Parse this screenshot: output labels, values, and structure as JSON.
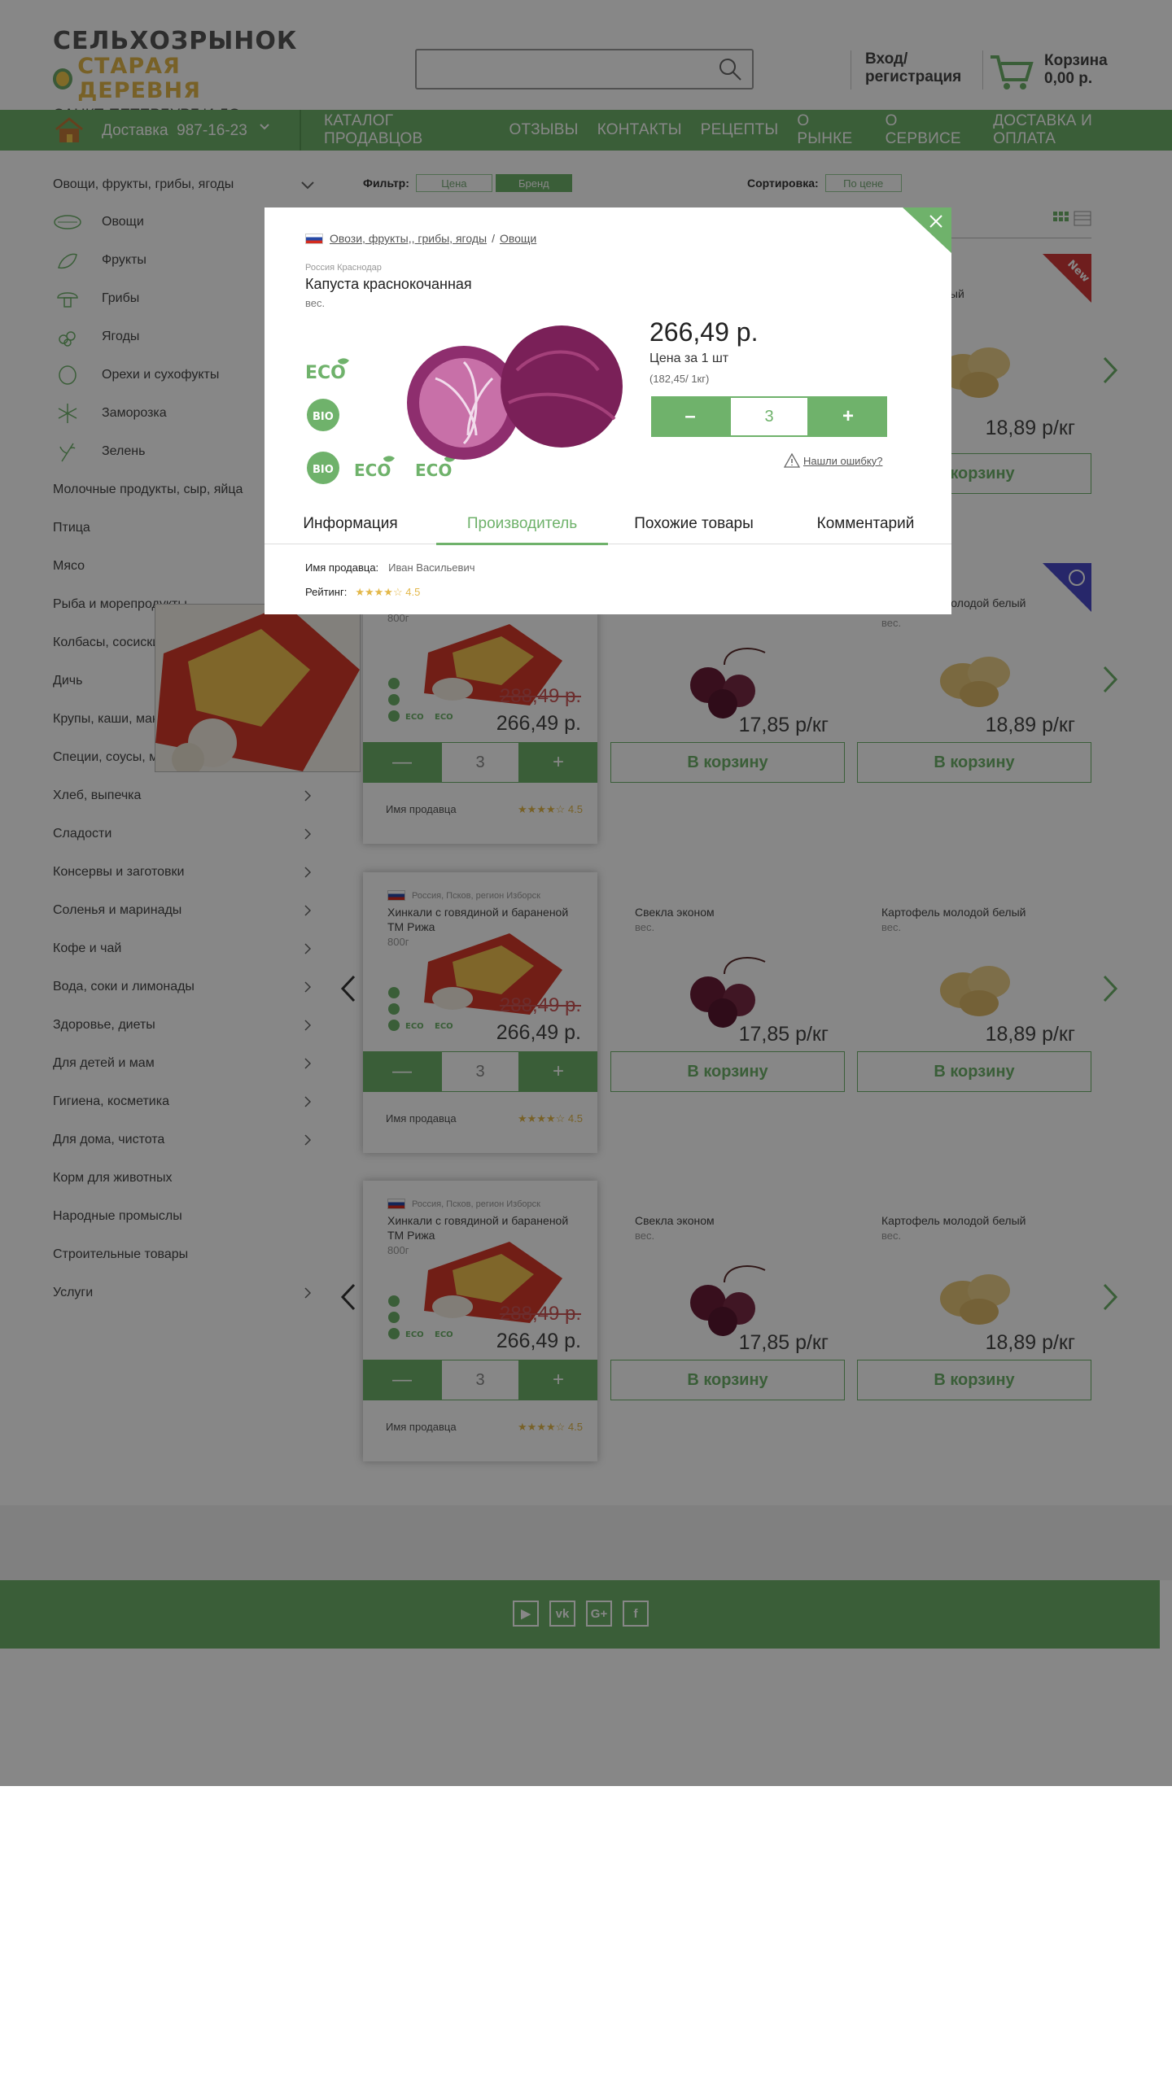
{
  "header": {
    "logo_line1": "СЕЛЬХОЗРЫНОК",
    "logo_line2": "СТАРАЯ ДЕРЕВНЯ",
    "logo_line3": "САНКТ-ПЕТЕРБУРГ И ЛО",
    "search_placeholder": "",
    "login_line1": "Вход/",
    "login_line2": "регистрация",
    "cart_label": "Корзина",
    "cart_sum": "0,00 р."
  },
  "nav": {
    "delivery": "Доставка",
    "phone": "987-16-23",
    "items": [
      "КАТАЛОГ ПРОДАВЦОВ",
      "ОТЗЫВЫ",
      "КОНТАКТЫ",
      "РЕЦЕПТЫ",
      "О РЫНКЕ",
      "О СЕРВИСЕ",
      "ДОСТАВКА И ОПЛАТА"
    ]
  },
  "sidebar": {
    "open_category": "Овощи, фрукты, грибы, ягоды",
    "subitems": [
      "Овощи",
      "Фрукты",
      "Грибы",
      "Ягоды",
      "Орехи и сухофукты",
      "Заморозка",
      "Зелень"
    ],
    "categories": [
      "Молочные продукты, сыр, яйца",
      "Птица",
      "Мясо",
      "Рыба и морепродукты",
      "Колбасы, сосиски",
      "Дичь",
      "Крупы, каши, мак",
      "Специи, соусы, ма",
      "Хлеб, выпечка",
      "Сладости",
      "Консервы и заготовки",
      "Соленья и маринады",
      "Кофе и чай",
      "Вода, соки и лимонады",
      "Здоровье, диеты",
      "Для детей и мам",
      "Гигиена, косметика",
      "Для дома, чистота",
      "Корм для животных",
      "Народные промыслы",
      "Строительные товары",
      "Услуги"
    ]
  },
  "filter": {
    "label": "Фильтр:",
    "price": "Цена",
    "brand": "Бренд"
  },
  "sort": {
    "label": "Сортировка:",
    "by_price": "По цене"
  },
  "products": {
    "khinkali": {
      "origin": "Россия, Псков, регион Изборск",
      "name": "Хинкали с говядиной и бараненой ТМ Рижа",
      "name_short": "ТМ Рижа",
      "weight": "800г",
      "old_price": "288,49 р.",
      "price": "266,49 р.",
      "qty": "3",
      "seller": "Имя продавца",
      "rating": "4.5"
    },
    "beet": {
      "name": "Свекла эконом",
      "unit": "вес.",
      "price": "17,85 р/кг",
      "to_cart": "В корзину"
    },
    "potato": {
      "name": "Картофель молодой белый",
      "name_partial": "молодой белый",
      "unit": "вес.",
      "price": "18,89 р/кг",
      "to_cart": "В корзину"
    }
  },
  "modal": {
    "breadcrumb": [
      "Овози, фрукты,, грибы, ягоды",
      "Овощи"
    ],
    "origin": "Россия  Краснодар",
    "title": "Капуста краснокочанная",
    "unit": "вес.",
    "price": "266,49 р.",
    "per_item": "Цена за 1 шт",
    "per_kg": "(182,45/ 1кг)",
    "qty": "3",
    "minus": "–",
    "plus": "+",
    "error_link": "Нашли ошибку?",
    "tabs": [
      "Информация",
      "Производитель",
      "Похожие товары",
      "Комментарий"
    ],
    "seller_label": "Имя продавца:",
    "seller_value": "Иван Васильевич",
    "rating_label": "Рейтинг:",
    "rating_value": "4.5"
  },
  "badges": {
    "new": "New"
  },
  "colors": {
    "accent": "#6fb26b",
    "logo_yellow": "#e3b84a",
    "badge_red": "#d23a3a",
    "badge_blue": "#4a4ac8"
  }
}
